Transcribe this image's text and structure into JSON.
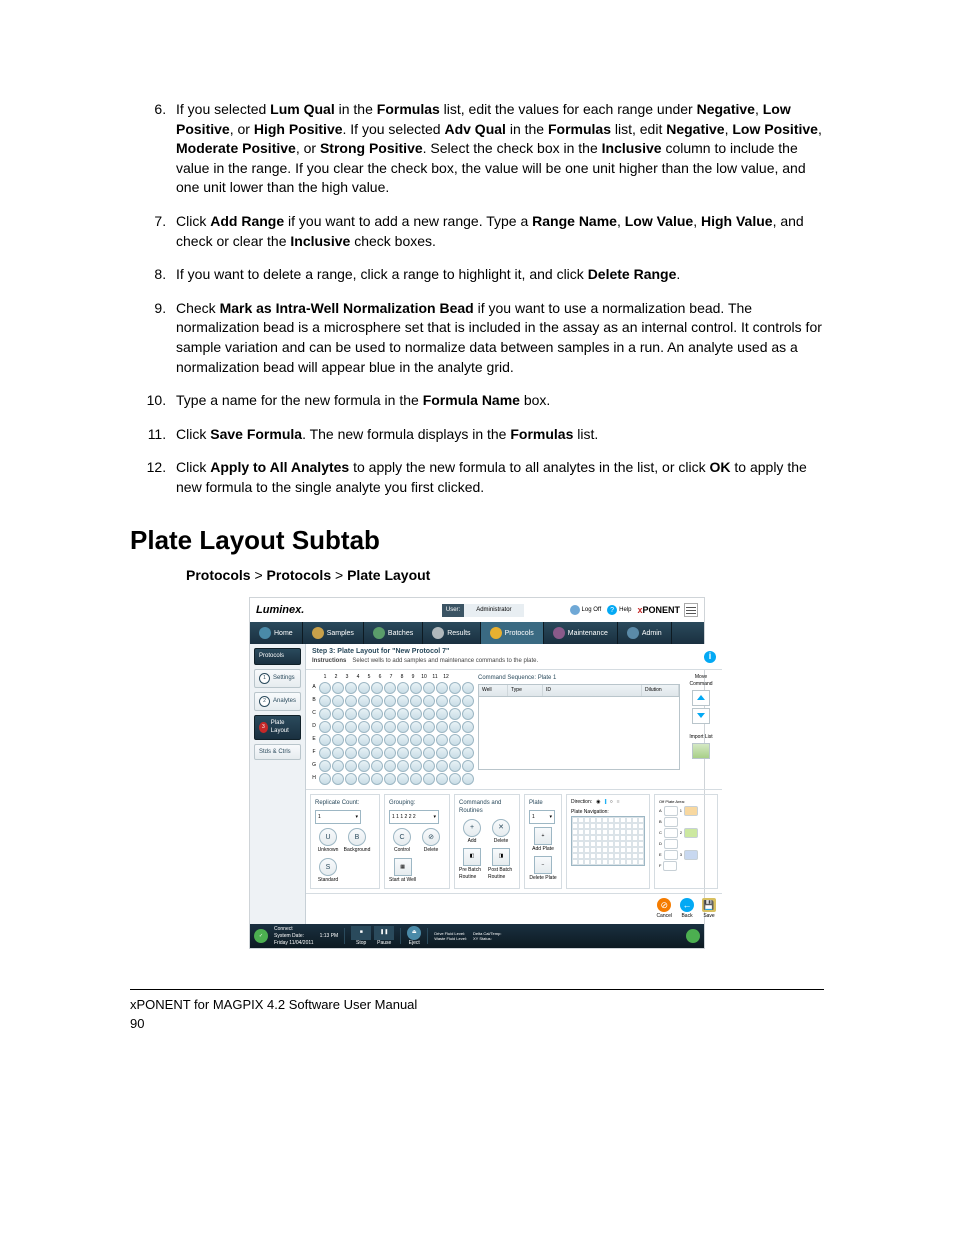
{
  "list": {
    "i6": {
      "t1": "If you selected ",
      "b1": "Lum Qual",
      "t2": " in the ",
      "b2": "Formulas",
      "t3": " list, edit the values for each range under ",
      "b3": "Negative",
      "t4": ", ",
      "b4": "Low Positive",
      "t5": ", or ",
      "b5": "High Positive",
      "t6": ". If you selected ",
      "b6": "Adv Qual",
      "t7": " in the ",
      "b7": "Formulas",
      "t8": " list, edit ",
      "b8": "Negative",
      "t9": ", ",
      "b9": "Low Positive",
      "t10": ", ",
      "b10": "Moderate Positive",
      "t11": ", or ",
      "b11": "Strong Positive",
      "t12": ". Select the check box in the ",
      "b12": "Inclusive",
      "t13": " column to include the value in the range. If you clear the check box, the value will be one unit higher than the low value, and one unit lower than the high value."
    },
    "i7": {
      "t1": "Click ",
      "b1": "Add Range",
      "t2": " if you want to add a new range. Type a ",
      "b2": "Range Name",
      "t3": ", ",
      "b3": "Low Value",
      "t4": ", ",
      "b4": "High Value",
      "t5": ", and check or clear the ",
      "b5": "Inclusive",
      "t6": " check boxes."
    },
    "i8": {
      "t1": "If you want to delete a range, click a range to highlight it, and click ",
      "b1": "Delete Range",
      "t2": "."
    },
    "i9": {
      "t1": "Check ",
      "b1": "Mark as Intra-Well Normalization Bead",
      "t2": " if you want to use a normalization bead. The normalization bead is a microsphere set that is included in the assay as an internal control. It controls for sample variation and can be used to normalize data between samples in a run. An analyte used as a normalization bead will appear blue in the analyte grid."
    },
    "i10": {
      "t1": "Type a name for the new formula in the ",
      "b1": "Formula Name",
      "t2": " box."
    },
    "i11": {
      "t1": "Click ",
      "b1": "Save Formula",
      "t2": ". The new formula displays in the ",
      "b2": "Formulas",
      "t3": " list."
    },
    "i12": {
      "t1": "Click ",
      "b1": "Apply to All Analytes",
      "t2": " to apply the new formula to all analytes in the list, or click ",
      "b2": "OK",
      "t3": " to apply the new formula to the single analyte you first clicked."
    }
  },
  "section_heading": "Plate Layout Subtab",
  "breadcrumb": {
    "a": "Protocols",
    "sep1": ">",
    "b": "Protocols",
    "sep2": ">",
    "c": "Plate Layout"
  },
  "fig": {
    "logo": "Luminex.",
    "user_label": "User:",
    "user_value": "Administrator",
    "logoff": "Log Off",
    "help": "Help",
    "brand": {
      "x": "x",
      "rest": "PONENT"
    },
    "tabs": {
      "home": "Home",
      "samples": "Samples",
      "batches": "Batches",
      "results": "Results",
      "protocols": "Protocols",
      "maintenance": "Maintenance",
      "admin": "Admin"
    },
    "side": {
      "protocols": "Protocols",
      "settings": "Settings",
      "analytes": "Analytes",
      "platelayout": "Plate Layout",
      "stdsctrls": "Stds & Ctrls",
      "n1": "1",
      "n2": "2",
      "n3": "3"
    },
    "step_title": "Step 3: Plate Layout for \"New Protocol 7\"",
    "instructions_label": "Instructions",
    "instructions_text": "Select wells to add samples and maintenance commands to the plate.",
    "plate_cols": [
      "1",
      "2",
      "3",
      "4",
      "5",
      "6",
      "7",
      "8",
      "9",
      "10",
      "11",
      "12"
    ],
    "plate_rows": [
      "A",
      "B",
      "C",
      "D",
      "E",
      "F",
      "G",
      "H"
    ],
    "cmd_title": "Command Sequence: Plate 1",
    "cmd_headers": {
      "well": "Well",
      "type": "Type",
      "id": "ID",
      "dilution": "Dilution"
    },
    "move_label": "Move Command",
    "import_label": "Import List",
    "replicate": {
      "title": "Replicate Count:",
      "value": "1"
    },
    "grouping": {
      "title": "Grouping:",
      "value": "1 1 1 2 2 2"
    },
    "btns": {
      "unknown": "Unknown",
      "background": "Background",
      "control": "Control",
      "delete": "Delete",
      "standard": "Standard",
      "startatwell": "Start at Well",
      "u": "U",
      "b": "B",
      "c": "C",
      "s": "S"
    },
    "cmdroutines": {
      "title": "Commands and Routines",
      "add": "Add",
      "delete": "Delete",
      "prebatch": "Pre Batch Routine",
      "postbatch": "Post Batch Routine"
    },
    "plate": {
      "title": "Plate",
      "value": "1",
      "addplate": "Add Plate",
      "deleteplate": "Delete Plate"
    },
    "direction": "Direction:",
    "platenav": "Plate Navigation:",
    "offplate": "Off Plate Area:",
    "footer": {
      "cancel": "Cancel",
      "back": "Back",
      "save": "Save"
    },
    "status": {
      "connect": "Connect",
      "sysdate": "System Date:",
      "date": "Friday 11/04/2011",
      "time": "1:13 PM",
      "stop": "Stop",
      "pause": "Pause",
      "eject": "Eject",
      "drive": "Drive Fluid Level:",
      "waste": "Waste Fluid Level:",
      "delta": "Delta Cal/Temp:",
      "xystatus": "XY Status:"
    }
  },
  "footer_line1": "xPONENT for MAGPIX 4.2 Software User Manual",
  "footer_line2": "90"
}
